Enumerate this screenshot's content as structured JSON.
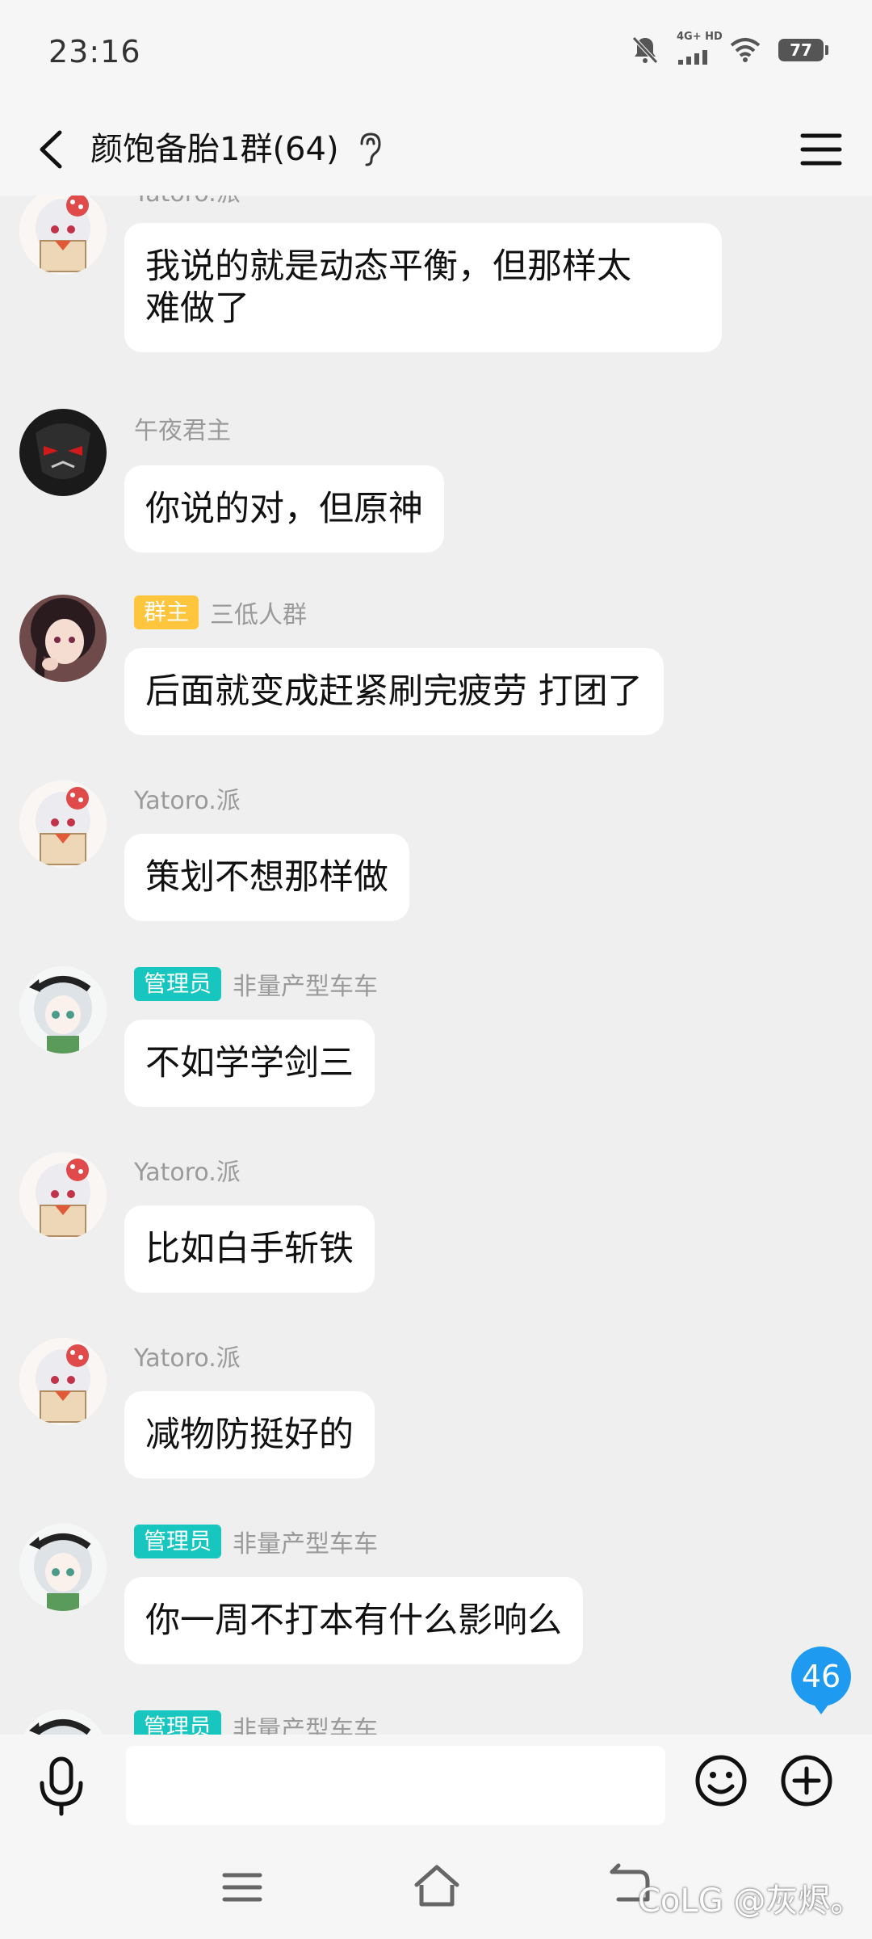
{
  "status_bar": {
    "time": "23:16",
    "network": "4G+ HD",
    "battery": "77"
  },
  "header": {
    "title": "颜饱备胎1群(64)"
  },
  "messages": [
    {
      "sender": "Yatoro.派",
      "badge": "",
      "text_lines": [
        "我说的就是动态平衡，但那样太",
        "难做了"
      ],
      "avatar": "avatar-white-hair-girl"
    },
    {
      "sender": "午夜君主",
      "badge": "",
      "text_lines": [
        "你说的对，但原神"
      ],
      "avatar": "avatar-dark-mask"
    },
    {
      "sender": "三低人群",
      "badge": "群主",
      "text_lines": [
        "后面就变成赶紧刷完疲劳 打团了"
      ],
      "avatar": "avatar-dark-hair-girl"
    },
    {
      "sender": "Yatoro.派",
      "badge": "",
      "text_lines": [
        "策划不想那样做"
      ],
      "avatar": "avatar-white-hair-girl"
    },
    {
      "sender": "非量产型车车",
      "badge": "管理员",
      "text_lines": [
        "不如学学剑三"
      ],
      "avatar": "avatar-silver-hair-girl"
    },
    {
      "sender": "Yatoro.派",
      "badge": "",
      "text_lines": [
        "比如白手斩铁"
      ],
      "avatar": "avatar-white-hair-girl"
    },
    {
      "sender": "Yatoro.派",
      "badge": "",
      "text_lines": [
        "减物防挺好的"
      ],
      "avatar": "avatar-white-hair-girl"
    },
    {
      "sender": "非量产型车车",
      "badge": "管理员",
      "text_lines": [
        "你一周不打本有什么影响么"
      ],
      "avatar": "avatar-silver-hair-girl"
    },
    {
      "sender": "非量产型车车",
      "badge": "管理员",
      "text_lines": [],
      "avatar": "avatar-silver-hair-girl"
    }
  ],
  "unread_count": "46",
  "input": {
    "placeholder": ""
  },
  "watermark": "CoLG @灰烬。",
  "colors": {
    "owner_badge": "#ffc53d",
    "admin_badge": "#18c6c0",
    "unread_blue": "#1e9bf0"
  }
}
